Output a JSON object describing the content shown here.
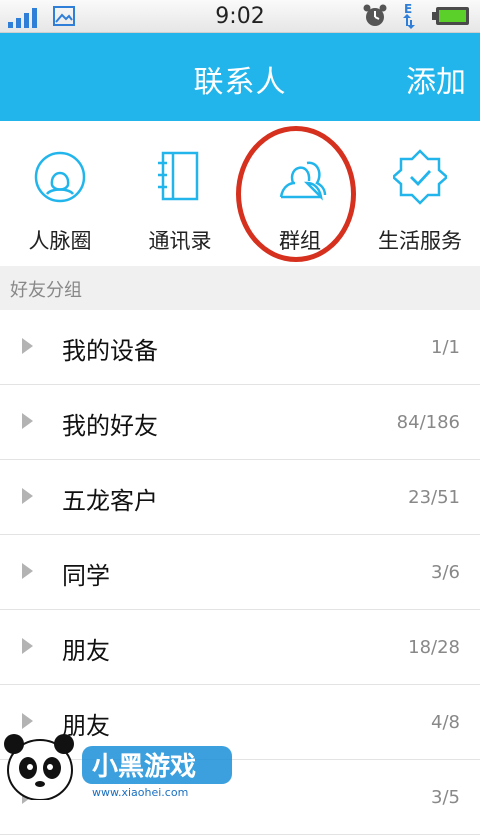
{
  "status_bar": {
    "time": "9:02"
  },
  "header": {
    "title": "联系人",
    "add_label": "添加"
  },
  "quick_entries": [
    {
      "label": "人脉圈",
      "icon": "person-circle-icon"
    },
    {
      "label": "通讯录",
      "icon": "contacts-book-icon"
    },
    {
      "label": "群组",
      "icon": "group-icon"
    },
    {
      "label": "生活服务",
      "icon": "service-badge-icon"
    }
  ],
  "section": {
    "label": "好友分组"
  },
  "groups": [
    {
      "name": "我的设备",
      "count": "1/1"
    },
    {
      "name": "我的好友",
      "count": "84/186"
    },
    {
      "name": "五龙客户",
      "count": "23/51"
    },
    {
      "name": "同学",
      "count": "3/6"
    },
    {
      "name": "朋友",
      "count": "18/28"
    },
    {
      "name": "朋友",
      "count": "4/8"
    },
    {
      "name": "",
      "count": "3/5"
    }
  ],
  "watermark": {
    "brand": "小黑游戏",
    "url": "www.xiaohei.com"
  },
  "colors": {
    "accent": "#22b5ec",
    "highlight": "#d6301e"
  }
}
